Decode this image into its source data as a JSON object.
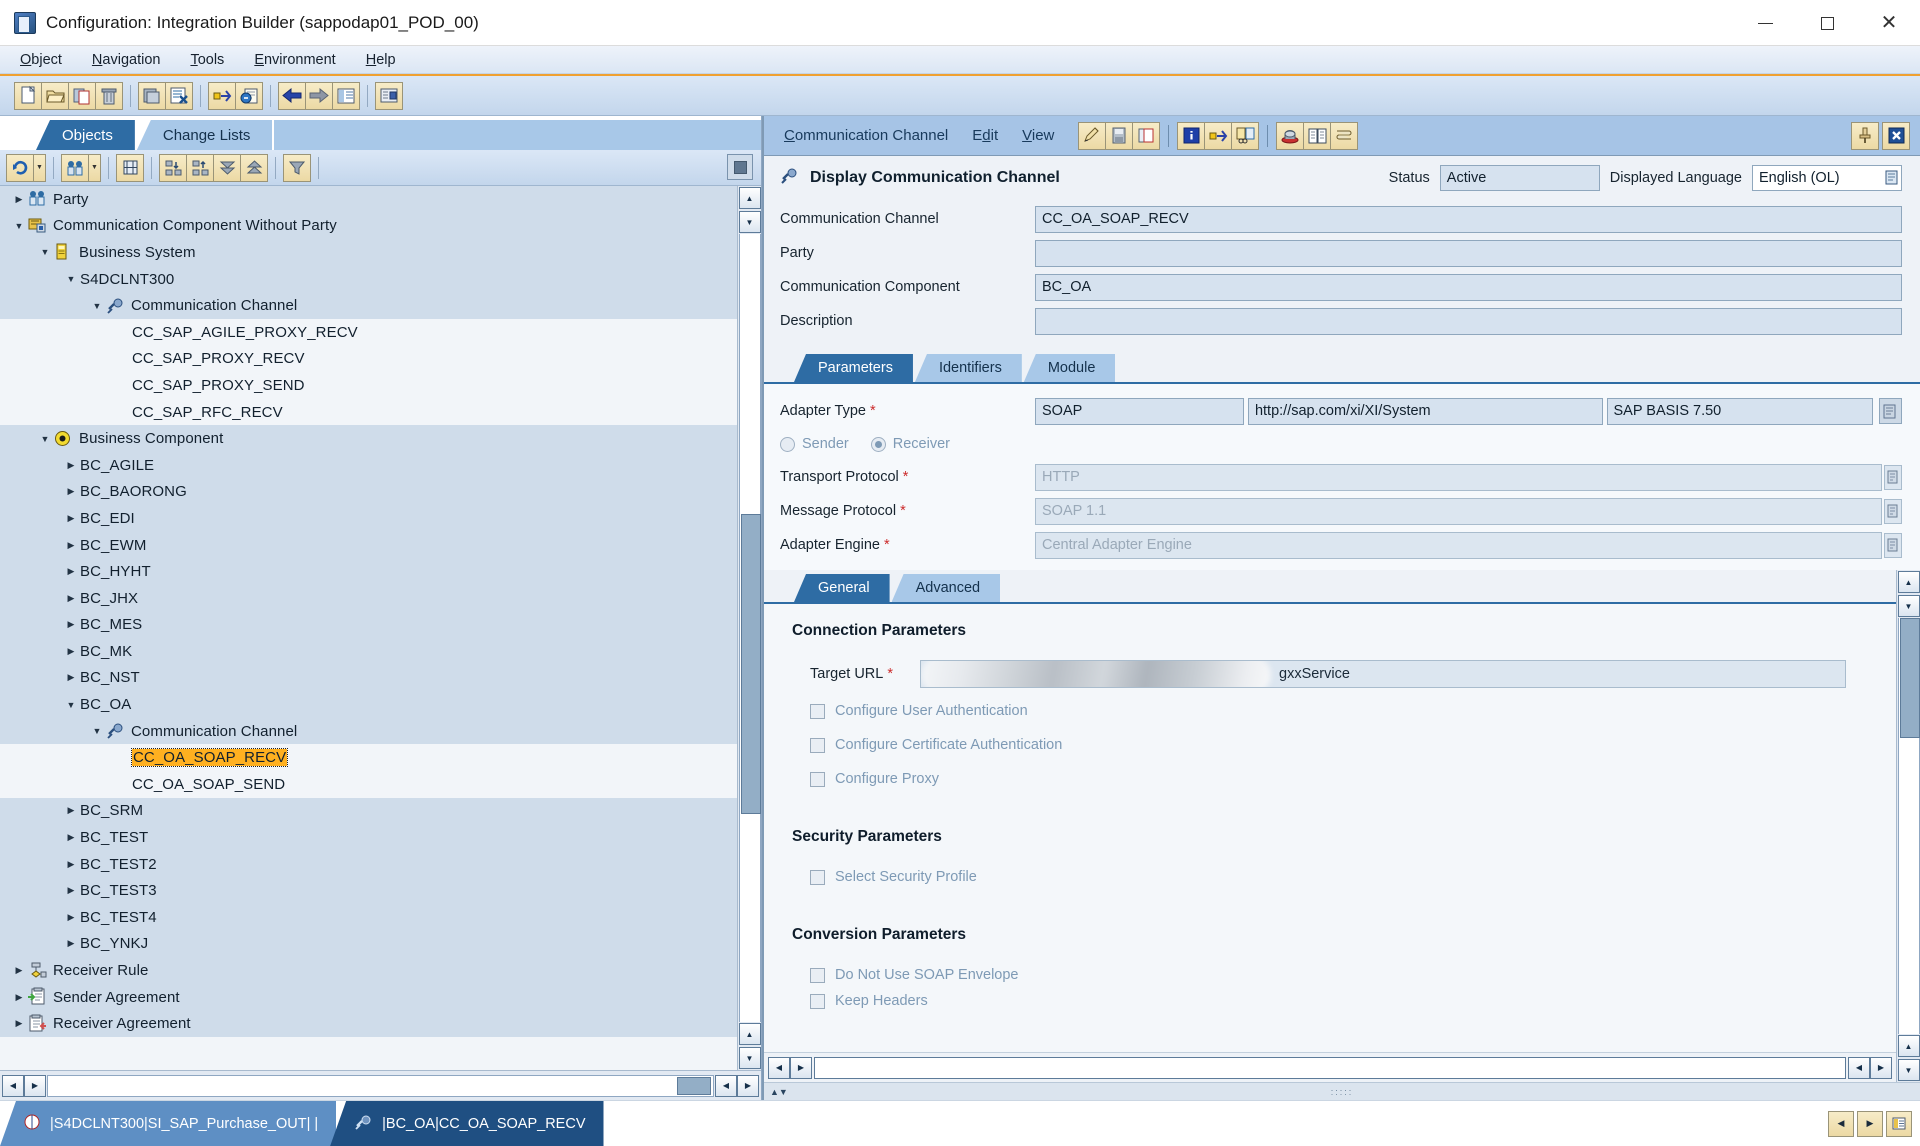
{
  "window": {
    "title": "Configuration: Integration Builder (sappodap01_POD_00)",
    "minimize_label": "Minimize",
    "maximize_label": "Maximize",
    "close_label": "Close"
  },
  "menubar": [
    {
      "label": "Object",
      "accel": "O"
    },
    {
      "label": "Navigation",
      "accel": "N"
    },
    {
      "label": "Tools",
      "accel": "T"
    },
    {
      "label": "Environment",
      "accel": "E"
    },
    {
      "label": "Help",
      "accel": "H"
    }
  ],
  "toolbar": {
    "groups": [
      [
        "new-icon",
        "open-icon",
        "copy-icon",
        "delete-icon"
      ],
      [
        "save-icon",
        "activate-icon"
      ],
      [
        "transport-icon",
        "where-used-icon"
      ],
      [
        "back-icon",
        "forward-icon",
        "list-icon"
      ],
      [
        "cache-notify-icon"
      ]
    ]
  },
  "left_panel": {
    "tabs": [
      {
        "label": "Objects",
        "active": true
      },
      {
        "label": "Change Lists",
        "active": false
      }
    ],
    "tree_toolbar": [
      "refresh-icon",
      "party-filter-icon",
      "find-icon",
      "expand-node-icon",
      "collapse-node-icon",
      "expand-all-icon",
      "collapse-all-icon",
      "filter-icon"
    ],
    "tree": [
      {
        "label": "Party",
        "indent": 0,
        "twisty": "right",
        "icon": "party-icon",
        "band": "a"
      },
      {
        "label": "Communication Component Without Party",
        "indent": 0,
        "twisty": "down",
        "icon": "comm-component-icon",
        "band": "a"
      },
      {
        "label": "Business System",
        "indent": 1,
        "twisty": "down",
        "icon": "business-system-icon",
        "band": "a"
      },
      {
        "label": "S4DCLNT300",
        "indent": 2,
        "twisty": "down",
        "icon": "none",
        "band": "a"
      },
      {
        "label": "Communication Channel",
        "indent": 3,
        "twisty": "down",
        "icon": "channel-icon",
        "band": "a"
      },
      {
        "label": "CC_SAP_AGILE_PROXY_RECV",
        "indent": 4,
        "twisty": "none",
        "icon": "none",
        "band": "b"
      },
      {
        "label": "CC_SAP_PROXY_RECV",
        "indent": 4,
        "twisty": "none",
        "icon": "none",
        "band": "b"
      },
      {
        "label": "CC_SAP_PROXY_SEND",
        "indent": 4,
        "twisty": "none",
        "icon": "none",
        "band": "b"
      },
      {
        "label": "CC_SAP_RFC_RECV",
        "indent": 4,
        "twisty": "none",
        "icon": "none",
        "band": "b"
      },
      {
        "label": "Business Component",
        "indent": 1,
        "twisty": "down",
        "icon": "business-component-icon",
        "band": "a"
      },
      {
        "label": "BC_AGILE",
        "indent": 2,
        "twisty": "right",
        "icon": "none",
        "band": "a"
      },
      {
        "label": "BC_BAORONG",
        "indent": 2,
        "twisty": "right",
        "icon": "none",
        "band": "a"
      },
      {
        "label": "BC_EDI",
        "indent": 2,
        "twisty": "right",
        "icon": "none",
        "band": "a"
      },
      {
        "label": "BC_EWM",
        "indent": 2,
        "twisty": "right",
        "icon": "none",
        "band": "a"
      },
      {
        "label": "BC_HYHT",
        "indent": 2,
        "twisty": "right",
        "icon": "none",
        "band": "a"
      },
      {
        "label": "BC_JHX",
        "indent": 2,
        "twisty": "right",
        "icon": "none",
        "band": "a"
      },
      {
        "label": "BC_MES",
        "indent": 2,
        "twisty": "right",
        "icon": "none",
        "band": "a"
      },
      {
        "label": "BC_MK",
        "indent": 2,
        "twisty": "right",
        "icon": "none",
        "band": "a"
      },
      {
        "label": "BC_NST",
        "indent": 2,
        "twisty": "right",
        "icon": "none",
        "band": "a"
      },
      {
        "label": "BC_OA",
        "indent": 2,
        "twisty": "down",
        "icon": "none",
        "band": "a"
      },
      {
        "label": "Communication Channel",
        "indent": 3,
        "twisty": "down",
        "icon": "channel-icon",
        "band": "a"
      },
      {
        "label": "CC_OA_SOAP_RECV",
        "indent": 4,
        "twisty": "none",
        "icon": "none",
        "band": "b",
        "selected": true
      },
      {
        "label": "CC_OA_SOAP_SEND",
        "indent": 4,
        "twisty": "none",
        "icon": "none",
        "band": "b"
      },
      {
        "label": "BC_SRM",
        "indent": 2,
        "twisty": "right",
        "icon": "none",
        "band": "a"
      },
      {
        "label": "BC_TEST",
        "indent": 2,
        "twisty": "right",
        "icon": "none",
        "band": "a"
      },
      {
        "label": "BC_TEST2",
        "indent": 2,
        "twisty": "right",
        "icon": "none",
        "band": "a"
      },
      {
        "label": "BC_TEST3",
        "indent": 2,
        "twisty": "right",
        "icon": "none",
        "band": "a"
      },
      {
        "label": "BC_TEST4",
        "indent": 2,
        "twisty": "right",
        "icon": "none",
        "band": "a"
      },
      {
        "label": "BC_YNKJ",
        "indent": 2,
        "twisty": "right",
        "icon": "none",
        "band": "a"
      },
      {
        "label": "Receiver Rule",
        "indent": 0,
        "twisty": "right",
        "icon": "receiver-rule-icon",
        "band": "a"
      },
      {
        "label": "Sender Agreement",
        "indent": 0,
        "twisty": "right",
        "icon": "sender-agreement-icon",
        "band": "a"
      },
      {
        "label": "Receiver Agreement",
        "indent": 0,
        "twisty": "right",
        "icon": "receiver-agreement-icon",
        "band": "a"
      }
    ]
  },
  "right_panel": {
    "menubar": [
      {
        "label": "Communication Channel",
        "accel": "C"
      },
      {
        "label": "Edit",
        "accel": "d"
      },
      {
        "label": "View",
        "accel": "V"
      }
    ],
    "menu_icons": [
      "edit-pencil-icon",
      "save-icon",
      "cancel-icon",
      "info-icon",
      "transport-icon",
      "compare-icon",
      "cache-icon",
      "documentation-icon",
      "history-icon"
    ],
    "window_icons": [
      "pin-icon",
      "close-panel-icon"
    ],
    "header": {
      "title": "Display Communication Channel",
      "title_icon": "channel-icon",
      "status_label": "Status",
      "status_value": "Active",
      "language_label": "Displayed Language",
      "language_value": "English (OL)"
    },
    "fields": [
      {
        "label": "Communication Channel",
        "value": "CC_OA_SOAP_RECV"
      },
      {
        "label": "Party",
        "value": ""
      },
      {
        "label": "Communication Component",
        "value": "BC_OA"
      },
      {
        "label": "Description",
        "value": ""
      }
    ],
    "tabs": [
      {
        "label": "Parameters",
        "active": true
      },
      {
        "label": "Identifiers",
        "active": false
      },
      {
        "label": "Module",
        "active": false
      }
    ],
    "adapter": {
      "type_label": "Adapter Type",
      "type_value": "SOAP",
      "namespace_value": "http://sap.com/xi/XI/System",
      "swcv_value": "SAP BASIS 7.50",
      "direction": {
        "sender_label": "Sender",
        "receiver_label": "Receiver",
        "selected": "Receiver"
      },
      "transport_protocol_label": "Transport Protocol",
      "transport_protocol_value": "HTTP",
      "message_protocol_label": "Message Protocol",
      "message_protocol_value": "SOAP 1.1",
      "adapter_engine_label": "Adapter Engine",
      "adapter_engine_value": "Central Adapter Engine"
    },
    "detail_tabs": [
      {
        "label": "General",
        "active": true
      },
      {
        "label": "Advanced",
        "active": false
      }
    ],
    "general": {
      "connection_section": "Connection Parameters",
      "target_url_label": "Target URL",
      "target_url_value": "gxxService",
      "target_url_redacted": true,
      "checkboxes_connection": [
        {
          "label": "Configure User Authentication",
          "checked": false
        },
        {
          "label": "Configure Certificate Authentication",
          "checked": false
        },
        {
          "label": "Configure Proxy",
          "checked": false
        }
      ],
      "security_section": "Security Parameters",
      "checkboxes_security": [
        {
          "label": "Select Security Profile",
          "checked": false
        }
      ],
      "conversion_section": "Conversion Parameters",
      "checkboxes_conversion": [
        {
          "label": "Do Not Use SOAP Envelope",
          "checked": false
        },
        {
          "label": "Keep Headers",
          "checked": false
        }
      ]
    }
  },
  "statusbar": {
    "tabs": [
      {
        "label": "|S4DCLNT300|SI_SAP_Purchase_OUT| |",
        "icon": "interface-icon",
        "active": false
      },
      {
        "label": "|BC_OA|CC_OA_SOAP_RECV",
        "icon": "channel-icon",
        "active": true
      }
    ],
    "nav_buttons": [
      "prev-icon",
      "next-icon",
      "list-icon"
    ]
  }
}
